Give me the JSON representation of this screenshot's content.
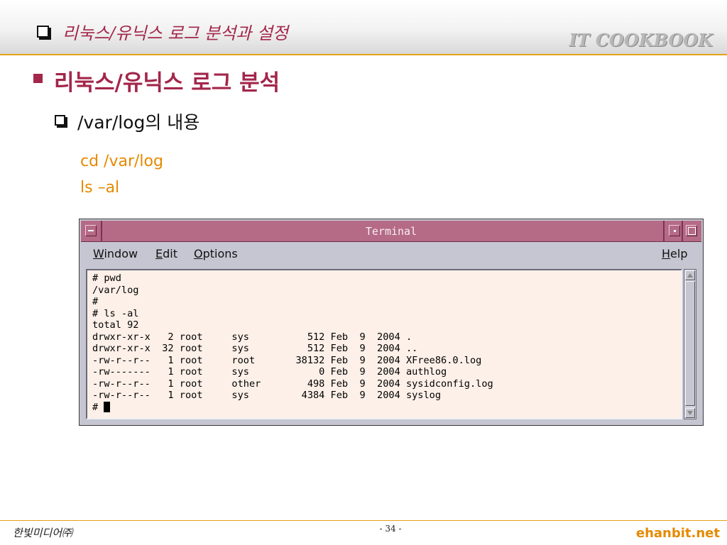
{
  "header": {
    "title": "리눅스/유닉스 로그 분석과 설정",
    "brand": "IT COOKBOOK"
  },
  "content": {
    "heading": "리눅스/유닉스 로그 분석",
    "subheading": "/var/log의 내용",
    "commands": [
      "cd /var/log",
      "ls –al"
    ]
  },
  "terminal": {
    "title": "Terminal",
    "menu": {
      "window": {
        "accel": "W",
        "rest": "indow"
      },
      "edit": {
        "accel": "E",
        "rest": "dit"
      },
      "options": {
        "accel": "O",
        "rest": "ptions"
      },
      "help": {
        "accel": "H",
        "rest": "elp"
      }
    },
    "output": "# pwd\n/var/log\n#\n# ls -al\ntotal 92\ndrwxr-xr-x   2 root     sys          512 Feb  9  2004 .\ndrwxr-xr-x  32 root     sys          512 Feb  9  2004 ..\n-rw-r--r--   1 root     root       38132 Feb  9  2004 XFree86.0.log\n-rw-------   1 root     sys            0 Feb  9  2004 authlog\n-rw-r--r--   1 root     other        498 Feb  9  2004 sysidconfig.log\n-rw-r--r--   1 root     sys         4384 Feb  9  2004 syslog",
    "prompt": "# "
  },
  "footer": {
    "publisher": "한빛미디어㈜",
    "page": "- 34 -",
    "site": "ehanbit.net"
  }
}
